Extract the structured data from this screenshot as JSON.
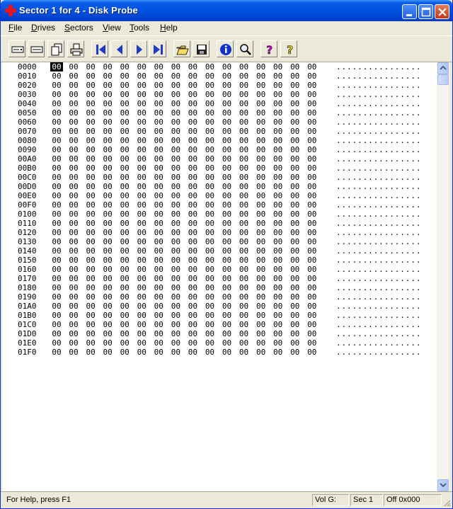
{
  "window": {
    "title": "Sector 1 for 4 - Disk Probe"
  },
  "menu": [
    {
      "pre": "",
      "ul": "F",
      "post": "ile"
    },
    {
      "pre": "",
      "ul": "D",
      "post": "rives"
    },
    {
      "pre": "",
      "ul": "S",
      "post": "ectors"
    },
    {
      "pre": "",
      "ul": "V",
      "post": "iew"
    },
    {
      "pre": "",
      "ul": "T",
      "post": "ools"
    },
    {
      "pre": "",
      "ul": "H",
      "post": "elp"
    }
  ],
  "toolbar_icons": [
    "drive-icon",
    "partition-icon",
    "copy-sectors-icon",
    "print-icon",
    "first-sector-icon",
    "previous-sector-icon",
    "next-sector-icon",
    "last-sector-icon",
    "open-file-icon",
    "save-icon",
    "info-icon",
    "search-icon",
    "help-icon",
    "context-help-icon"
  ],
  "hex": {
    "offsets": [
      "0000",
      "0010",
      "0020",
      "0030",
      "0040",
      "0050",
      "0060",
      "0070",
      "0080",
      "0090",
      "00A0",
      "00B0",
      "00C0",
      "00D0",
      "00E0",
      "00F0",
      "0100",
      "0110",
      "0120",
      "0130",
      "0140",
      "0150",
      "0160",
      "0170",
      "0180",
      "0190",
      "01A0",
      "01B0",
      "01C0",
      "01D0",
      "01E0",
      "01F0"
    ],
    "byte_value": "00",
    "bytes_per_row": 16,
    "selected_byte": "0000",
    "ascii": "................"
  },
  "status": {
    "help_text": "For Help, press F1",
    "volume": "Vol  G:",
    "sector": "Sec 1",
    "offset": "Off 0x000"
  },
  "colors": {
    "title_bar": "#0054e3",
    "nav_arrow": "#1a3cc8",
    "help_icon": "#c000c0",
    "info_icon": "#1030d0"
  }
}
